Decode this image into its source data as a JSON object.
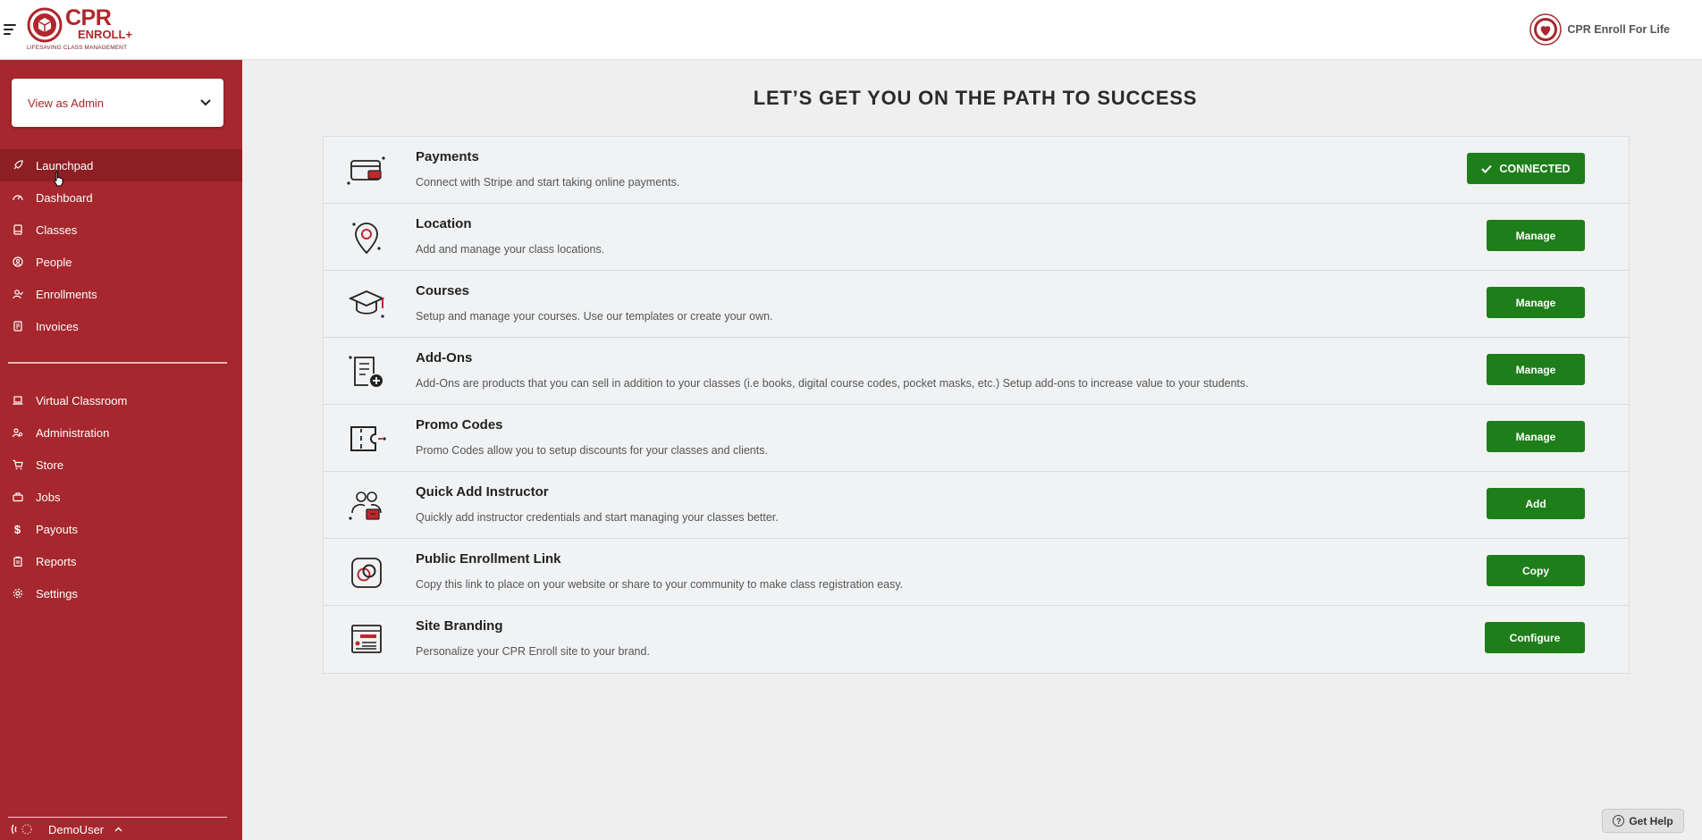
{
  "header": {
    "logo_main": "CPR",
    "logo_sub": "ENROLL+",
    "logo_tagline": "LIFESAVING CLASS MANAGEMENT",
    "org_name": "CPR Enroll For Life"
  },
  "sidebar": {
    "view_select": "View as Admin",
    "primary_items": [
      {
        "label": "Launchpad",
        "icon": "rocket-icon",
        "active": true
      },
      {
        "label": "Dashboard",
        "icon": "gauge-icon"
      },
      {
        "label": "Classes",
        "icon": "book-icon"
      },
      {
        "label": "People",
        "icon": "person-circle-icon"
      },
      {
        "label": "Enrollments",
        "icon": "user-check-icon"
      },
      {
        "label": "Invoices",
        "icon": "invoice-icon"
      }
    ],
    "secondary_items": [
      {
        "label": "Virtual Classroom",
        "icon": "laptop-icon"
      },
      {
        "label": "Administration",
        "icon": "admin-users-icon"
      },
      {
        "label": "Store",
        "icon": "cart-icon"
      },
      {
        "label": "Jobs",
        "icon": "briefcase-icon"
      },
      {
        "label": "Payouts",
        "icon": "dollar-icon"
      },
      {
        "label": "Reports",
        "icon": "clipboard-icon"
      },
      {
        "label": "Settings",
        "icon": "gear-icon"
      }
    ],
    "user": "DemoUser"
  },
  "main": {
    "heading": "LET’S GET YOU ON THE PATH TO SUCCESS",
    "cards": [
      {
        "title": "Payments",
        "desc": "Connect with Stripe and start taking online payments.",
        "button": "CONNECTED",
        "icon": "credit-card-icon"
      },
      {
        "title": "Location",
        "desc": "Add and manage your class locations.",
        "button": "Manage",
        "icon": "location-pin-icon"
      },
      {
        "title": "Courses",
        "desc": "Setup and manage your courses. Use our templates or create your own.",
        "button": "Manage",
        "icon": "graduation-cap-icon"
      },
      {
        "title": "Add-Ons",
        "desc": "Add-Ons are products that you can sell in addition to your classes (i.e books, digital course codes, pocket masks, etc.) Setup add-ons to increase value to your students.",
        "button": "Manage",
        "icon": "addon-list-icon"
      },
      {
        "title": "Promo Codes",
        "desc": "Promo Codes allow you to setup discounts for your classes and clients.",
        "button": "Manage",
        "icon": "ticket-icon"
      },
      {
        "title": "Quick Add Instructor",
        "desc": "Quickly add instructor credentials and start managing your classes better.",
        "button": "Add",
        "icon": "instructor-icon"
      },
      {
        "title": "Public Enrollment Link",
        "desc": "Copy this link to place on your website or share to your community to make class registration easy.",
        "button": "Copy",
        "icon": "link-icon"
      },
      {
        "title": "Site Branding",
        "desc": "Personalize your CPR Enroll site to your brand.",
        "button": "Configure",
        "icon": "browser-window-icon"
      }
    ],
    "help": "Get Help"
  },
  "colors": {
    "brand_red": "#a6272d",
    "button_green": "#1e7e1a"
  }
}
